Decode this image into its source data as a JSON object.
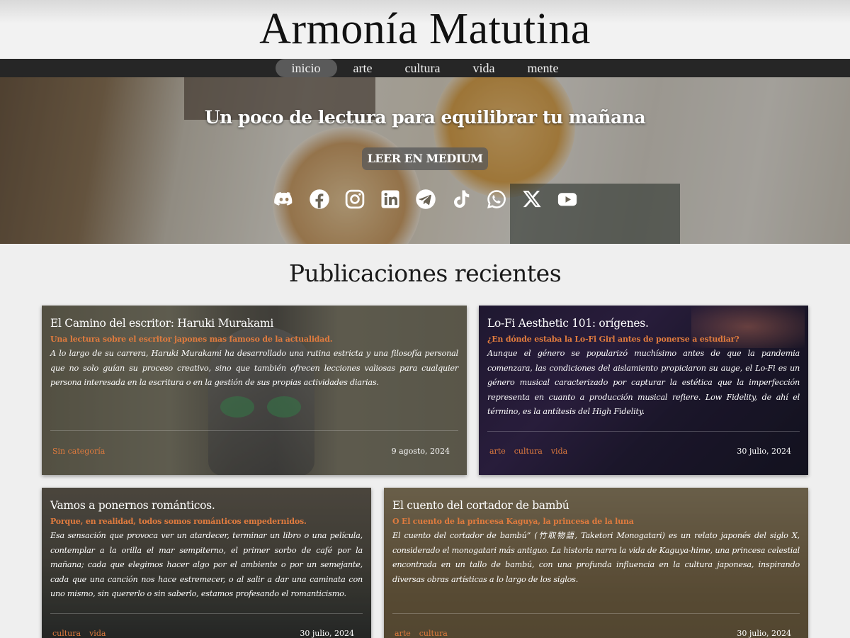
{
  "site": {
    "title": "Armonía Matutina"
  },
  "nav": {
    "items": [
      {
        "label": "inicio",
        "active": true
      },
      {
        "label": "arte",
        "active": false
      },
      {
        "label": "cultura",
        "active": false
      },
      {
        "label": "vida",
        "active": false
      },
      {
        "label": "mente",
        "active": false
      }
    ]
  },
  "hero": {
    "tagline": "Un poco de lectura para equilibrar tu mañana",
    "button_label": "LEER EN MEDIUM",
    "social_icons": [
      "discord-icon",
      "facebook-icon",
      "instagram-icon",
      "linkedin-icon",
      "telegram-icon",
      "tiktok-icon",
      "whatsapp-icon",
      "x-icon",
      "youtube-icon"
    ]
  },
  "section": {
    "title": "Publicaciones recientes"
  },
  "posts": [
    {
      "title": "El Camino del escritor: Haruki Murakami",
      "subtitle": "Una lectura sobre el escritor japones mas famoso de la actualidad.",
      "excerpt": " A lo largo de su carrera, Haruki Murakami ha desarrollado una rutina estricta y una filosofía personal que no solo guían su proceso creativo, sino que también ofrecen lecciones valiosas para cualquier persona interesada en la escritura o en la gestión de sus propias actividades diarias.",
      "tags": [
        "Sin categoría"
      ],
      "date": "9 agosto, 2024"
    },
    {
      "title": "Lo-Fi Aesthetic 101: orígenes.",
      "subtitle": "¿En dónde estaba la Lo-Fi Girl antes de ponerse a estudiar?",
      "excerpt": "Aunque el género se popularizó muchísimo antes de que la pandemia comenzara, las condiciones del aislamiento propiciaron su auge, el Lo-Fi es un género musical caracterizado por capturar la estética que la imperfección representa en cuanto a producción musical refiere. Low Fidelity, de ahí el término, es la antítesis del High Fidelity.",
      "tags": [
        "arte",
        "cultura",
        "vida"
      ],
      "date": "30 julio, 2024"
    },
    {
      "title": "Vamos a ponernos románticos.",
      "subtitle": "Porque, en realidad, todos somos románticos empedernidos.",
      "excerpt": "Esa sensación que provoca ver un atardecer, terminar un libro o una película, contemplar a la orilla el mar sempiterno, el primer sorbo de café por la mañana; cada que elegimos hacer algo por el ambiente o por un semejante, cada que una canción nos hace estremecer, o al salir a dar una caminata con uno mismo, sin quererlo o sin saberlo, estamos profesando el romanticismo.",
      "tags": [
        "cultura",
        "vida"
      ],
      "date": "30 julio, 2024"
    },
    {
      "title": "El cuento del cortador de bambú",
      "subtitle": "O El cuento de la princesa Kaguya, la princesa de la luna",
      "excerpt": "El cuento del cortador de bambú” (竹取物語, Taketori Monogatari) es un relato japonés del siglo X, considerado el monogatari más antiguo. La historia narra la vida de Kaguya-hime, una princesa celestial encontrada en un tallo de bambú, con una profunda influencia en la cultura japonesa, inspirando diversas obras artísticas a lo largo de los siglos.",
      "tags": [
        "arte",
        "cultura"
      ],
      "date": "30 julio, 2024"
    }
  ]
}
